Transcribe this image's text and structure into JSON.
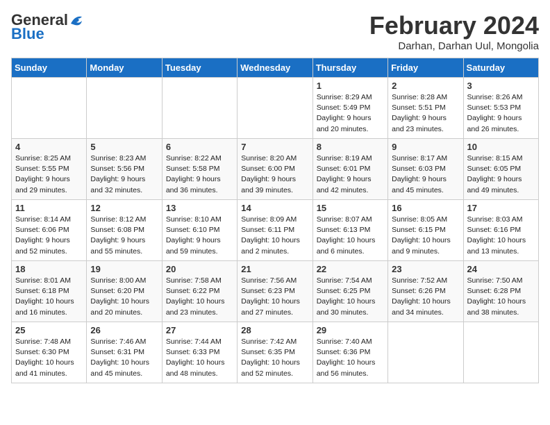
{
  "header": {
    "logo_general": "General",
    "logo_blue": "Blue",
    "title": "February 2024",
    "subtitle": "Darhan, Darhan Uul, Mongolia"
  },
  "weekdays": [
    "Sunday",
    "Monday",
    "Tuesday",
    "Wednesday",
    "Thursday",
    "Friday",
    "Saturday"
  ],
  "weeks": [
    [
      {
        "day": "",
        "info": ""
      },
      {
        "day": "",
        "info": ""
      },
      {
        "day": "",
        "info": ""
      },
      {
        "day": "",
        "info": ""
      },
      {
        "day": "1",
        "info": "Sunrise: 8:29 AM\nSunset: 5:49 PM\nDaylight: 9 hours\nand 20 minutes."
      },
      {
        "day": "2",
        "info": "Sunrise: 8:28 AM\nSunset: 5:51 PM\nDaylight: 9 hours\nand 23 minutes."
      },
      {
        "day": "3",
        "info": "Sunrise: 8:26 AM\nSunset: 5:53 PM\nDaylight: 9 hours\nand 26 minutes."
      }
    ],
    [
      {
        "day": "4",
        "info": "Sunrise: 8:25 AM\nSunset: 5:55 PM\nDaylight: 9 hours\nand 29 minutes."
      },
      {
        "day": "5",
        "info": "Sunrise: 8:23 AM\nSunset: 5:56 PM\nDaylight: 9 hours\nand 32 minutes."
      },
      {
        "day": "6",
        "info": "Sunrise: 8:22 AM\nSunset: 5:58 PM\nDaylight: 9 hours\nand 36 minutes."
      },
      {
        "day": "7",
        "info": "Sunrise: 8:20 AM\nSunset: 6:00 PM\nDaylight: 9 hours\nand 39 minutes."
      },
      {
        "day": "8",
        "info": "Sunrise: 8:19 AM\nSunset: 6:01 PM\nDaylight: 9 hours\nand 42 minutes."
      },
      {
        "day": "9",
        "info": "Sunrise: 8:17 AM\nSunset: 6:03 PM\nDaylight: 9 hours\nand 45 minutes."
      },
      {
        "day": "10",
        "info": "Sunrise: 8:15 AM\nSunset: 6:05 PM\nDaylight: 9 hours\nand 49 minutes."
      }
    ],
    [
      {
        "day": "11",
        "info": "Sunrise: 8:14 AM\nSunset: 6:06 PM\nDaylight: 9 hours\nand 52 minutes."
      },
      {
        "day": "12",
        "info": "Sunrise: 8:12 AM\nSunset: 6:08 PM\nDaylight: 9 hours\nand 55 minutes."
      },
      {
        "day": "13",
        "info": "Sunrise: 8:10 AM\nSunset: 6:10 PM\nDaylight: 9 hours\nand 59 minutes."
      },
      {
        "day": "14",
        "info": "Sunrise: 8:09 AM\nSunset: 6:11 PM\nDaylight: 10 hours\nand 2 minutes."
      },
      {
        "day": "15",
        "info": "Sunrise: 8:07 AM\nSunset: 6:13 PM\nDaylight: 10 hours\nand 6 minutes."
      },
      {
        "day": "16",
        "info": "Sunrise: 8:05 AM\nSunset: 6:15 PM\nDaylight: 10 hours\nand 9 minutes."
      },
      {
        "day": "17",
        "info": "Sunrise: 8:03 AM\nSunset: 6:16 PM\nDaylight: 10 hours\nand 13 minutes."
      }
    ],
    [
      {
        "day": "18",
        "info": "Sunrise: 8:01 AM\nSunset: 6:18 PM\nDaylight: 10 hours\nand 16 minutes."
      },
      {
        "day": "19",
        "info": "Sunrise: 8:00 AM\nSunset: 6:20 PM\nDaylight: 10 hours\nand 20 minutes."
      },
      {
        "day": "20",
        "info": "Sunrise: 7:58 AM\nSunset: 6:22 PM\nDaylight: 10 hours\nand 23 minutes."
      },
      {
        "day": "21",
        "info": "Sunrise: 7:56 AM\nSunset: 6:23 PM\nDaylight: 10 hours\nand 27 minutes."
      },
      {
        "day": "22",
        "info": "Sunrise: 7:54 AM\nSunset: 6:25 PM\nDaylight: 10 hours\nand 30 minutes."
      },
      {
        "day": "23",
        "info": "Sunrise: 7:52 AM\nSunset: 6:26 PM\nDaylight: 10 hours\nand 34 minutes."
      },
      {
        "day": "24",
        "info": "Sunrise: 7:50 AM\nSunset: 6:28 PM\nDaylight: 10 hours\nand 38 minutes."
      }
    ],
    [
      {
        "day": "25",
        "info": "Sunrise: 7:48 AM\nSunset: 6:30 PM\nDaylight: 10 hours\nand 41 minutes."
      },
      {
        "day": "26",
        "info": "Sunrise: 7:46 AM\nSunset: 6:31 PM\nDaylight: 10 hours\nand 45 minutes."
      },
      {
        "day": "27",
        "info": "Sunrise: 7:44 AM\nSunset: 6:33 PM\nDaylight: 10 hours\nand 48 minutes."
      },
      {
        "day": "28",
        "info": "Sunrise: 7:42 AM\nSunset: 6:35 PM\nDaylight: 10 hours\nand 52 minutes."
      },
      {
        "day": "29",
        "info": "Sunrise: 7:40 AM\nSunset: 6:36 PM\nDaylight: 10 hours\nand 56 minutes."
      },
      {
        "day": "",
        "info": ""
      },
      {
        "day": "",
        "info": ""
      }
    ]
  ]
}
